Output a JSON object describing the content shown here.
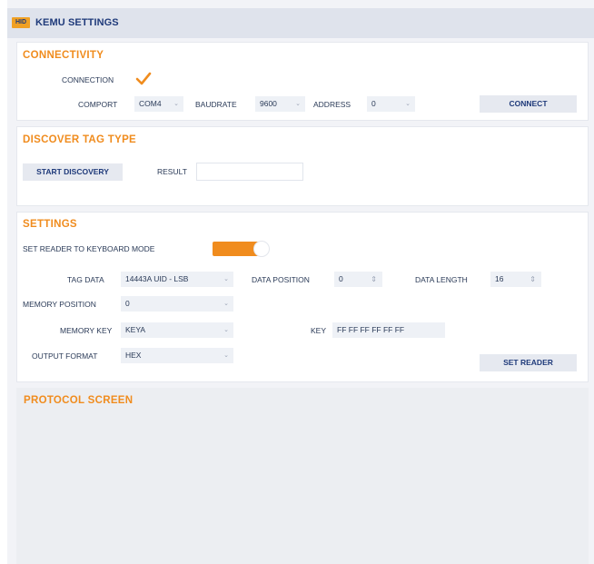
{
  "window": {
    "logo_text": "HID",
    "title": "KEMU SETTINGS"
  },
  "connectivity": {
    "title": "CONNECTIVITY",
    "connection_label": "CONNECTION",
    "connection_checked": true,
    "comport_label": "COMPORT",
    "comport_value": "COM4",
    "baudrate_label": "BAUDRATE",
    "baudrate_value": "9600",
    "address_label": "ADDRESS",
    "address_value": "0",
    "connect_button": "CONNECT"
  },
  "discover": {
    "title": "DISCOVER TAG TYPE",
    "start_button": "START DISCOVERY",
    "result_label": "RESULT",
    "result_value": ""
  },
  "settings": {
    "title": "SETTINGS",
    "keyboard_mode_label": "SET READER TO KEYBOARD MODE",
    "keyboard_mode_on": true,
    "tag_data_label": "TAG DATA",
    "tag_data_value": "14443A UID - LSB",
    "data_position_label": "DATA POSITION",
    "data_position_value": "0",
    "data_length_label": "DATA LENGTH",
    "data_length_value": "16",
    "memory_position_label": "MEMORY POSITION",
    "memory_position_value": "0",
    "memory_key_label": "MEMORY KEY",
    "memory_key_value": "KEYA",
    "key_label": "KEY",
    "key_value": "FF FF FF FF FF FF",
    "output_format_label": "OUTPUT FORMAT",
    "output_format_value": "HEX",
    "set_reader_button": "SET READER"
  },
  "protocol": {
    "title": "PROTOCOL SCREEN",
    "content": ""
  },
  "colors": {
    "accent_orange": "#f08c1e",
    "brand_navy": "#1f3a7a",
    "field_bg": "#eef1f6",
    "titlebar_bg": "#dfe3ec"
  },
  "icons": {
    "check": "checkmark-icon",
    "dropdown": "chevron-down-icon",
    "spinner": "spinner-arrows-icon"
  }
}
